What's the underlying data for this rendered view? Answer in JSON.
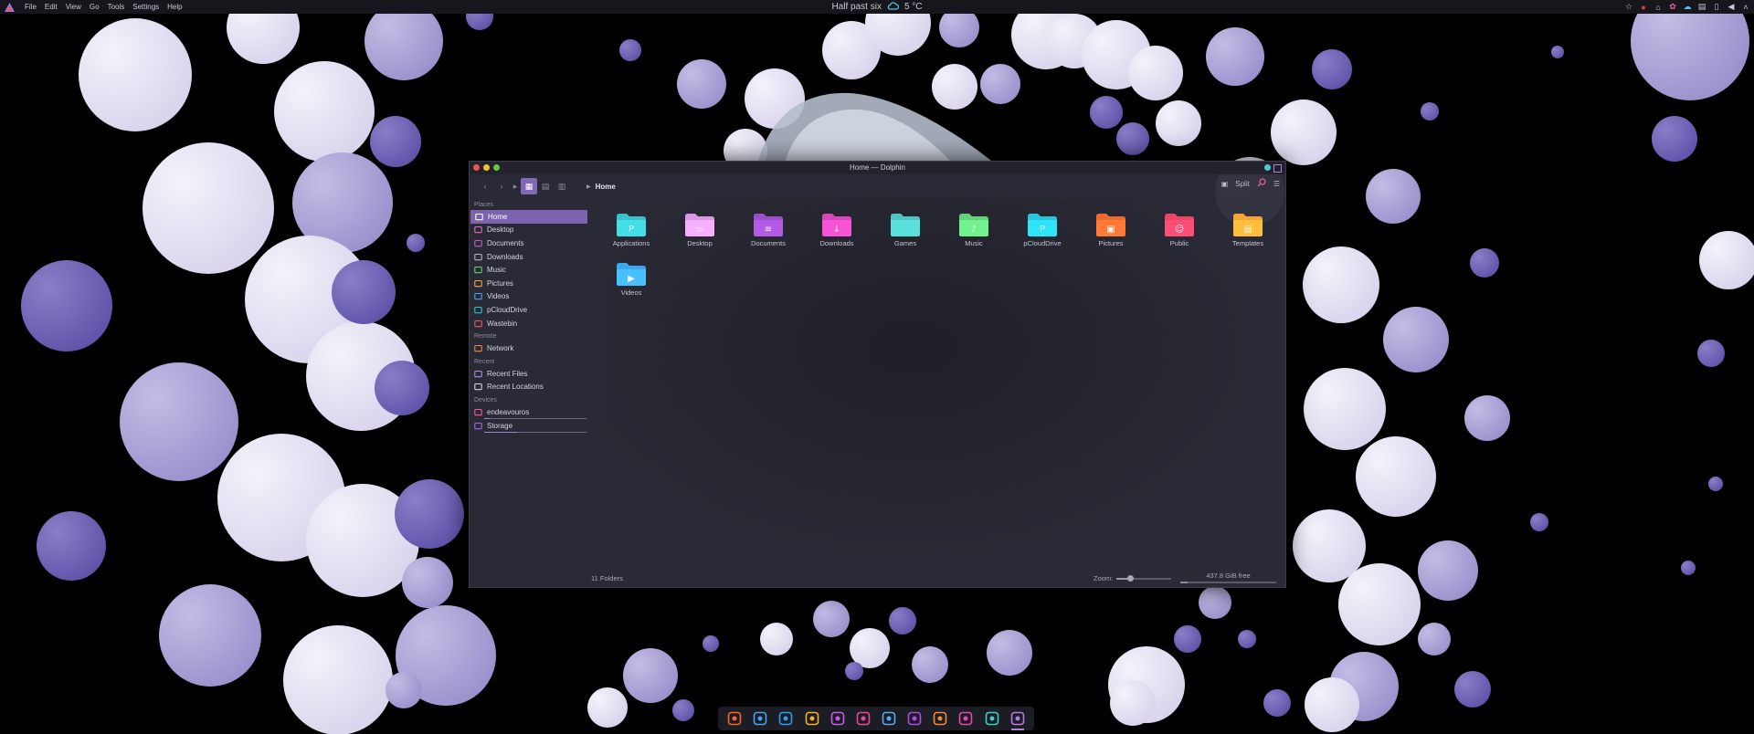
{
  "panel": {
    "menu": [
      "File",
      "Edit",
      "View",
      "Go",
      "Tools",
      "Settings",
      "Help"
    ],
    "clock": "Half past six",
    "weather": "5 °C"
  },
  "window": {
    "title": "Home — Dolphin",
    "breadcrumb": "Home",
    "split_label": "Split"
  },
  "sidebar": {
    "places_title": "Places",
    "places": [
      {
        "label": "Home",
        "icon": "home-icon",
        "color": "#ffffff"
      },
      {
        "label": "Desktop",
        "icon": "desktop-icon",
        "color": "#e26ab2"
      },
      {
        "label": "Documents",
        "icon": "documents-icon",
        "color": "#c45ac8"
      },
      {
        "label": "Downloads",
        "icon": "downloads-icon",
        "color": "#b2b2c4"
      },
      {
        "label": "Music",
        "icon": "music-icon",
        "color": "#62d27a"
      },
      {
        "label": "Pictures",
        "icon": "pictures-icon",
        "color": "#f2a540"
      },
      {
        "label": "Videos",
        "icon": "videos-icon",
        "color": "#3fa6f0"
      },
      {
        "label": "pCloudDrive",
        "icon": "pcloud-icon",
        "color": "#27c6d8"
      },
      {
        "label": "Wastebin",
        "icon": "wastebin-icon",
        "color": "#e85a6a"
      }
    ],
    "remote_title": "Remote",
    "remote": [
      {
        "label": "Network",
        "icon": "network-icon",
        "color": "#f08a3a"
      }
    ],
    "recent_title": "Recent",
    "recent": [
      {
        "label": "Recent Files",
        "icon": "recent-files-icon",
        "color": "#b08ae8"
      },
      {
        "label": "Recent Locations",
        "icon": "recent-locations-icon",
        "color": "#d4d4e0"
      }
    ],
    "devices_title": "Devices",
    "devices": [
      {
        "label": "endeavouros",
        "icon": "drive-icon",
        "color": "#f05a9a",
        "used": 0.05
      },
      {
        "label": "Storage",
        "icon": "drive-icon",
        "color": "#9a6ae8",
        "used": 0.32
      }
    ]
  },
  "folders": [
    {
      "label": "Applications",
      "color": "#39c2c8",
      "glyph": "P"
    },
    {
      "label": "Desktop",
      "color": "#d898e6",
      "glyph": "▭"
    },
    {
      "label": "Documents",
      "color": "#9c4fc8",
      "glyph": "≡"
    },
    {
      "label": "Downloads",
      "color": "#d649b8",
      "glyph": "↓"
    },
    {
      "label": "Games",
      "color": "#4fc4c0",
      "glyph": ""
    },
    {
      "label": "Music",
      "color": "#62d27a",
      "glyph": "♪"
    },
    {
      "label": "pCloudDrive",
      "color": "#27c6d8",
      "glyph": "P"
    },
    {
      "label": "Pictures",
      "color": "#f06a30",
      "glyph": "▣"
    },
    {
      "label": "Public",
      "color": "#ee4466",
      "glyph": "☺"
    },
    {
      "label": "Templates",
      "color": "#f6a534",
      "glyph": "▤"
    },
    {
      "label": "Videos",
      "color": "#3fa6f0",
      "glyph": "▶"
    }
  ],
  "status": {
    "count": "11 Folders",
    "zoom_label": "Zoom:",
    "zoom_level": 0.25,
    "free": "437.8 GiB free",
    "used_fraction": 0.08
  },
  "dock": [
    {
      "icon": "firefox-icon",
      "color": "#f2662a"
    },
    {
      "icon": "mail-icon",
      "color": "#3fa6f0"
    },
    {
      "icon": "telegram-icon",
      "color": "#2aa0e8"
    },
    {
      "icon": "code-editor-icon",
      "color": "#f5b02a"
    },
    {
      "icon": "git-icon",
      "color": "#c060e0"
    },
    {
      "icon": "vector-icon",
      "color": "#e84a9a"
    },
    {
      "icon": "shield-icon",
      "color": "#5aa8f0"
    },
    {
      "icon": "video-editor-icon",
      "color": "#b04ae0"
    },
    {
      "icon": "chat-icon",
      "color": "#f08a3a"
    },
    {
      "icon": "screenshot-icon",
      "color": "#e24ab0"
    },
    {
      "icon": "settings-icon",
      "color": "#3fd0c8"
    },
    {
      "icon": "files-icon",
      "color": "#b47be0"
    }
  ]
}
